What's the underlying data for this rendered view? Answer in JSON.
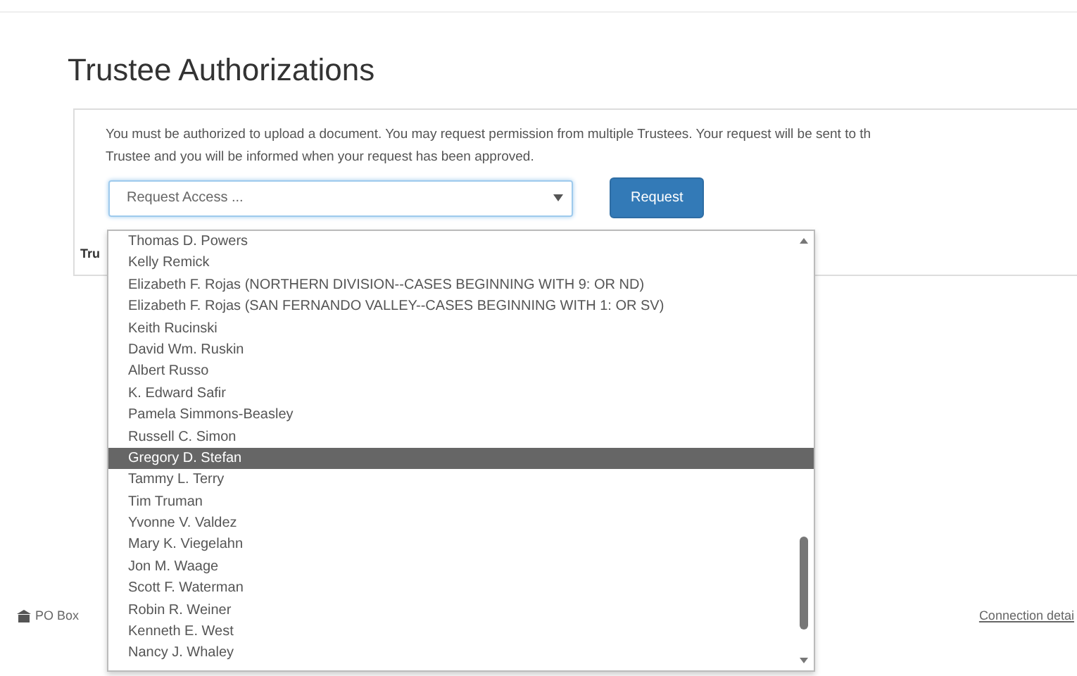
{
  "page": {
    "title": "Trustee Authorizations"
  },
  "panel": {
    "message": "You must be authorized to upload a document. You may request permission from multiple Trustees. Your request will be sent to th\nTrustee and you will be informed when your request has been approved.",
    "select": {
      "value": "Request Access ..."
    },
    "button": "Request",
    "table_header": "Tru"
  },
  "dropdown": {
    "items": [
      {
        "label": "Thomas D. Powers",
        "selected": false
      },
      {
        "label": "Kelly Remick",
        "selected": false
      },
      {
        "label": "Elizabeth F. Rojas (NORTHERN DIVISION--CASES BEGINNING WITH 9: OR ND)",
        "selected": false
      },
      {
        "label": "Elizabeth F. Rojas (SAN FERNANDO VALLEY--CASES BEGINNING WITH 1: OR SV)",
        "selected": false
      },
      {
        "label": "Keith Rucinski",
        "selected": false
      },
      {
        "label": "David Wm. Ruskin",
        "selected": false
      },
      {
        "label": "Albert Russo",
        "selected": false
      },
      {
        "label": "K. Edward Safir",
        "selected": false
      },
      {
        "label": "Pamela Simmons-Beasley",
        "selected": false
      },
      {
        "label": "Russell C. Simon",
        "selected": false
      },
      {
        "label": "Gregory D. Stefan",
        "selected": true
      },
      {
        "label": "Tammy L. Terry",
        "selected": false
      },
      {
        "label": "Tim Truman",
        "selected": false
      },
      {
        "label": "Yvonne V. Valdez",
        "selected": false
      },
      {
        "label": "Mary K. Viegelahn",
        "selected": false
      },
      {
        "label": "Jon M. Waage",
        "selected": false
      },
      {
        "label": "Scott F. Waterman",
        "selected": false
      },
      {
        "label": "Robin R. Weiner",
        "selected": false
      },
      {
        "label": "Kenneth E. West",
        "selected": false
      },
      {
        "label": "Nancy J. Whaley",
        "selected": false
      }
    ]
  },
  "footer": {
    "address": "PO Box",
    "link": "Connection detai"
  }
}
